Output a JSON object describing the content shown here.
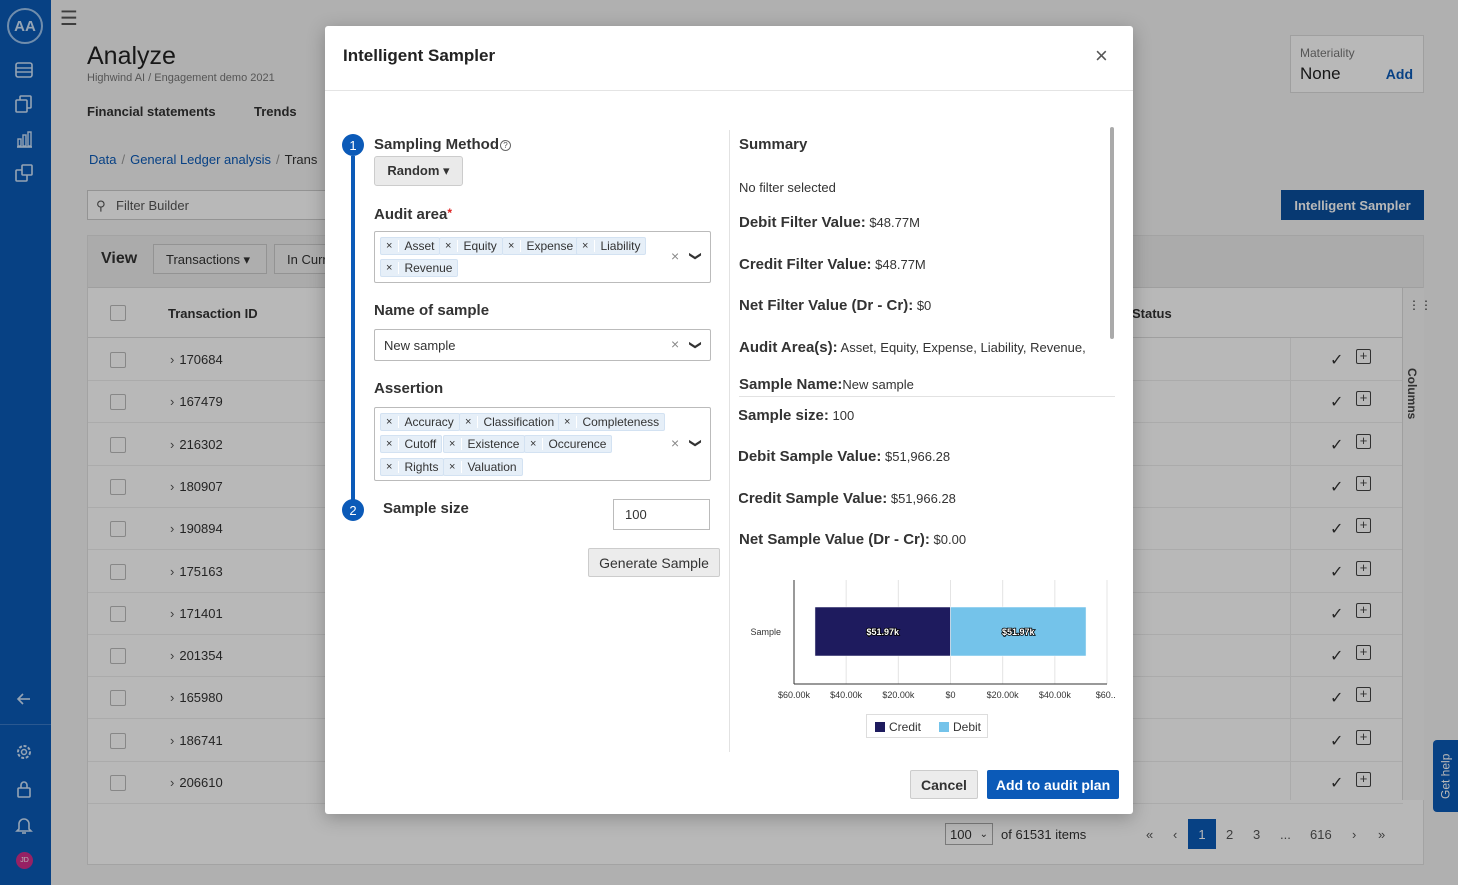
{
  "sidebar": {
    "logo_text": "AA",
    "icons": [
      "database-icon",
      "documents-icon",
      "bar-chart-icon",
      "tasks-icon"
    ],
    "bottom_icons": [
      "collapse-arrow-icon",
      "gear-icon",
      "lock-icon",
      "bell-icon"
    ],
    "avatar_initials": "JD"
  },
  "header": {
    "title": "Analyze",
    "subtitle": "Highwind AI / Engagement demo 2021",
    "tabs": [
      "Financial statements",
      "Trends"
    ],
    "materiality": {
      "label": "Materiality",
      "value": "None",
      "add_label": "Add"
    }
  },
  "breadcrumb": {
    "items": [
      "Data",
      "General Ledger analysis"
    ],
    "current": "Trans"
  },
  "filter": {
    "placeholder": "Filter Builder"
  },
  "intelligent_sampler_button": "Intelligent Sampler",
  "grid": {
    "view_label": "View",
    "toolbar_buttons": [
      "Transactions ▾",
      "In Curr"
    ],
    "columns": [
      "Transaction ID",
      "Status"
    ],
    "rows": [
      "170684",
      "167479",
      "216302",
      "180907",
      "190894",
      "175163",
      "171401",
      "201354",
      "165980",
      "186741",
      "206610"
    ],
    "columns_tab_label": "Columns"
  },
  "pagination": {
    "page_size": "100",
    "total_text": "of 61531 items",
    "first": "«",
    "prev": "‹",
    "next": "›",
    "last": "»",
    "pages": [
      "1",
      "2",
      "3",
      "...",
      "616"
    ],
    "active_page": "1"
  },
  "get_help": "Get help",
  "modal": {
    "title": "Intelligent Sampler",
    "close": "×",
    "step1": "1",
    "step2": "2",
    "sampling_method": {
      "label": "Sampling Method",
      "help": "?",
      "value": "Random ▾"
    },
    "audit_area": {
      "label": "Audit area",
      "required": "*",
      "chips": [
        "Asset",
        "Equity",
        "Expense",
        "Liability",
        "Revenue"
      ]
    },
    "sample_name": {
      "label": "Name of sample",
      "value": "New sample"
    },
    "assertion": {
      "label": "Assertion",
      "chips": [
        "Accuracy",
        "Classification",
        "Completeness",
        "Cutoff",
        "Existence",
        "Occurence",
        "Rights",
        "Valuation"
      ]
    },
    "sample_size": {
      "label": "Sample size",
      "value": "100"
    },
    "chip_remove": "×",
    "clear": "×",
    "caret": "❯",
    "generate_button": "Generate Sample",
    "summary": {
      "title": "Summary",
      "filter_text": "No filter selected",
      "debit_filter": {
        "label": "Debit Filter Value:",
        "value": "$48.77M"
      },
      "credit_filter": {
        "label": "Credit Filter Value:",
        "value": "$48.77M"
      },
      "net_filter": {
        "label": "Net Filter Value (Dr - Cr):",
        "value": "$0"
      },
      "audit_areas": {
        "label": "Audit Area(s):",
        "value": "Asset, Equity, Expense, Liability, Revenue,"
      },
      "sample_name": {
        "label": "Sample Name:",
        "value": "New sample"
      },
      "sample_size": {
        "label": "Sample size:",
        "value": "100"
      },
      "debit_sample": {
        "label": "Debit Sample Value:",
        "value": "$51,966.28"
      },
      "credit_sample": {
        "label": "Credit Sample Value:",
        "value": "$51,966.28"
      },
      "net_sample": {
        "label": "Net Sample Value (Dr - Cr):",
        "value": "$0.00"
      }
    },
    "cancel_button": "Cancel",
    "add_button": "Add to audit plan"
  },
  "chart_data": {
    "type": "bar",
    "orientation": "horizontal-diverging",
    "categories": [
      "Sample"
    ],
    "series": [
      {
        "name": "Credit",
        "values": [
          -51966.28
        ],
        "label": "$51.97k",
        "color": "#1e1b5e"
      },
      {
        "name": "Debit",
        "values": [
          51966.28
        ],
        "label": "$51.97k",
        "color": "#74c3ea"
      }
    ],
    "xlim": [
      -60000,
      60000
    ],
    "x_ticks": [
      "$60.00k",
      "$40.00k",
      "$20.00k",
      "$0",
      "$20.00k",
      "$40.00k",
      "$60..."
    ],
    "x_tick_values": [
      -60000,
      -40000,
      -20000,
      0,
      20000,
      40000,
      60000
    ],
    "grid": true,
    "legend": "bottom-center"
  }
}
